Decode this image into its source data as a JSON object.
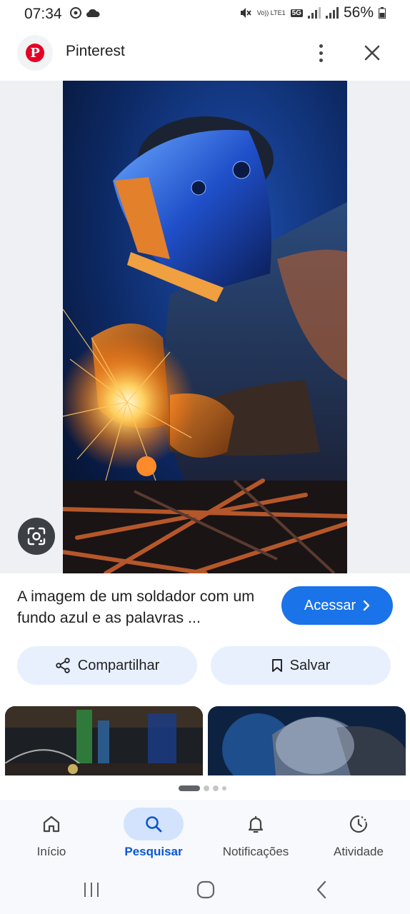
{
  "status_bar": {
    "time": "07:34",
    "battery": "56%",
    "lte_label": "Vo)) LTE1",
    "network_label": "5G"
  },
  "header": {
    "title": "Pinterest",
    "logo_icon": "pinterest-logo-icon",
    "logo_letter": "P"
  },
  "result": {
    "description": "A imagem de um soldador com um fundo azul e as palavras ...",
    "visit_label": "Acessar",
    "share_label": "Compartilhar",
    "save_label": "Salvar"
  },
  "bottom_nav": {
    "items": [
      {
        "label": "Início",
        "icon": "home-icon",
        "active": false
      },
      {
        "label": "Pesquisar",
        "icon": "search-icon",
        "active": true
      },
      {
        "label": "Notificações",
        "icon": "bell-icon",
        "active": false
      },
      {
        "label": "Atividade",
        "icon": "activity-icon",
        "active": false
      }
    ]
  },
  "colors": {
    "accent": "#1a73e8",
    "chip_bg": "#e8f0fe",
    "active_nav_bg": "#d3e3fd",
    "active_nav_text": "#0b57d0",
    "pinterest_red": "#e60023"
  }
}
